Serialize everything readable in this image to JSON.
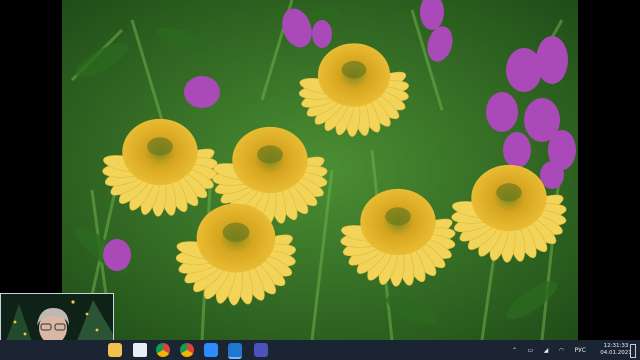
{
  "video": {
    "content": "Yellow echinacea flowers with purple penstemon in a garden"
  },
  "webcam": {
    "label": "presenter webcam"
  },
  "taskbar": {
    "icons": [
      "file-explorer-icon",
      "chrome-icon",
      "chrome-icon",
      "zoom-icon",
      "onedrive-icon",
      "teams-icon"
    ],
    "tray": {
      "language": "РУС",
      "clock_time": "12:31:33",
      "clock_date": "04.01.2021"
    }
  },
  "colors": {
    "taskbar": "#1b2432",
    "petal": "#f5d95a",
    "center": "#e8b322",
    "foliage": "#3a7a2a",
    "purple": "#a94ab8"
  }
}
